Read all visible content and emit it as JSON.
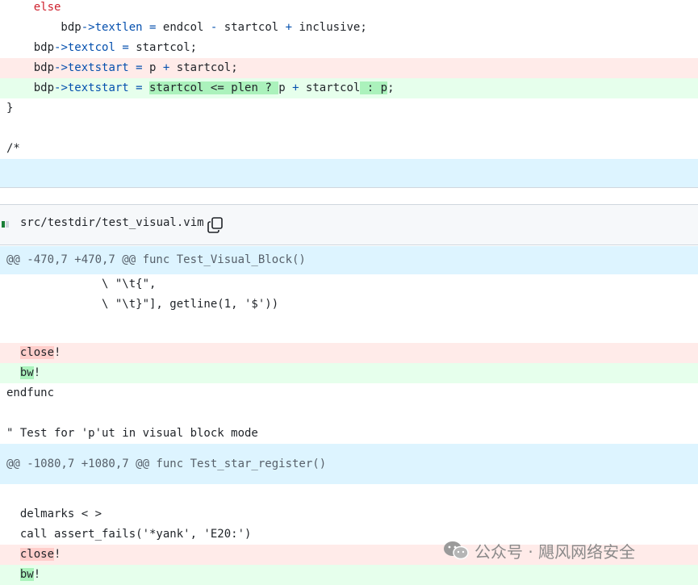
{
  "top_lines": [
    {
      "type": "ctx",
      "segments": [
        {
          "t": "    "
        },
        {
          "t": "else",
          "c": "kw"
        }
      ]
    },
    {
      "type": "ctx",
      "segments": [
        {
          "t": "        bdp"
        },
        {
          "t": "->",
          "c": "op"
        },
        {
          "t": "textlen",
          "c": "mem"
        },
        {
          "t": " "
        },
        {
          "t": "=",
          "c": "op"
        },
        {
          "t": " endcol "
        },
        {
          "t": "-",
          "c": "op"
        },
        {
          "t": " startcol "
        },
        {
          "t": "+",
          "c": "op"
        },
        {
          "t": " inclusive;"
        }
      ]
    },
    {
      "type": "ctx",
      "segments": [
        {
          "t": "    bdp"
        },
        {
          "t": "->",
          "c": "op"
        },
        {
          "t": "textcol",
          "c": "mem"
        },
        {
          "t": " "
        },
        {
          "t": "=",
          "c": "op"
        },
        {
          "t": " startcol;"
        }
      ]
    },
    {
      "type": "del",
      "segments": [
        {
          "t": "    bdp"
        },
        {
          "t": "->",
          "c": "op"
        },
        {
          "t": "textstart",
          "c": "mem"
        },
        {
          "t": " "
        },
        {
          "t": "=",
          "c": "op"
        },
        {
          "t": " p "
        },
        {
          "t": "+",
          "c": "op"
        },
        {
          "t": " startcol;"
        }
      ]
    },
    {
      "type": "add",
      "segments": [
        {
          "t": "    bdp"
        },
        {
          "t": "->",
          "c": "op"
        },
        {
          "t": "textstart",
          "c": "mem"
        },
        {
          "t": " "
        },
        {
          "t": "=",
          "c": "op"
        },
        {
          "t": " "
        },
        {
          "t": "startcol <= plen ? ",
          "c": "hl-add"
        },
        {
          "t": "p "
        },
        {
          "t": "+",
          "c": "op"
        },
        {
          "t": " startcol"
        },
        {
          "t": " : p",
          "c": "hl-add"
        },
        {
          "t": ";"
        }
      ]
    },
    {
      "type": "ctx",
      "segments": [
        {
          "t": "}"
        }
      ]
    },
    {
      "type": "ctx",
      "segments": [
        {
          "t": ""
        }
      ]
    },
    {
      "type": "ctx",
      "segments": [
        {
          "t": "/*"
        }
      ]
    },
    {
      "type": "hunk",
      "segments": [
        {
          "t": ""
        }
      ]
    }
  ],
  "file": {
    "path": "src/testdir/test_visual.vim",
    "copy_icon": "copy-icon"
  },
  "bottom_lines": [
    {
      "type": "hunk",
      "segments": [
        {
          "t": "@@ -470,7 +470,7 @@ func Test_Visual_Block()"
        }
      ]
    },
    {
      "type": "ctx",
      "segments": [
        {
          "t": "              \\ \"\\t{\","
        }
      ]
    },
    {
      "type": "ctx",
      "segments": [
        {
          "t": "              \\ \"\\t}\"], getline(1, '$'))"
        }
      ]
    },
    {
      "type": "ctx",
      "segments": [
        {
          "t": ""
        }
      ]
    },
    {
      "type": "del",
      "segments": [
        {
          "t": "  "
        },
        {
          "t": "close",
          "c": "hl-del"
        },
        {
          "t": "!"
        }
      ]
    },
    {
      "type": "add",
      "segments": [
        {
          "t": "  "
        },
        {
          "t": "bw",
          "c": "hl-add"
        },
        {
          "t": "!"
        }
      ]
    },
    {
      "type": "ctx",
      "segments": [
        {
          "t": "endfunc"
        }
      ]
    },
    {
      "type": "ctx",
      "segments": [
        {
          "t": ""
        }
      ]
    },
    {
      "type": "ctx",
      "segments": [
        {
          "t": "\" Test for 'p'ut in visual block mode"
        }
      ]
    },
    {
      "type": "hunk2",
      "segments": [
        {
          "t": "@@ -1080,7 +1080,7 @@ func Test_star_register()"
        }
      ]
    },
    {
      "type": "ctx",
      "segments": [
        {
          "t": ""
        }
      ]
    },
    {
      "type": "ctx",
      "segments": [
        {
          "t": "  delmarks < >"
        }
      ]
    },
    {
      "type": "ctx",
      "segments": [
        {
          "t": "  call assert_fails('*yank', 'E20:')"
        }
      ]
    },
    {
      "type": "del",
      "segments": [
        {
          "t": "  "
        },
        {
          "t": "close",
          "c": "hl-del"
        },
        {
          "t": "!"
        }
      ]
    },
    {
      "type": "add",
      "segments": [
        {
          "t": "  "
        },
        {
          "t": "bw",
          "c": "hl-add"
        },
        {
          "t": "!"
        }
      ]
    }
  ],
  "watermark": {
    "text": "公众号 · 飓风网络安全",
    "icon": "wechat-icon"
  },
  "colors": {
    "add_bg": "#e6ffec",
    "del_bg": "#ffebe9",
    "hunk_bg": "#ddf4ff",
    "keyword": "#cf222e",
    "member": "#0550ae"
  }
}
